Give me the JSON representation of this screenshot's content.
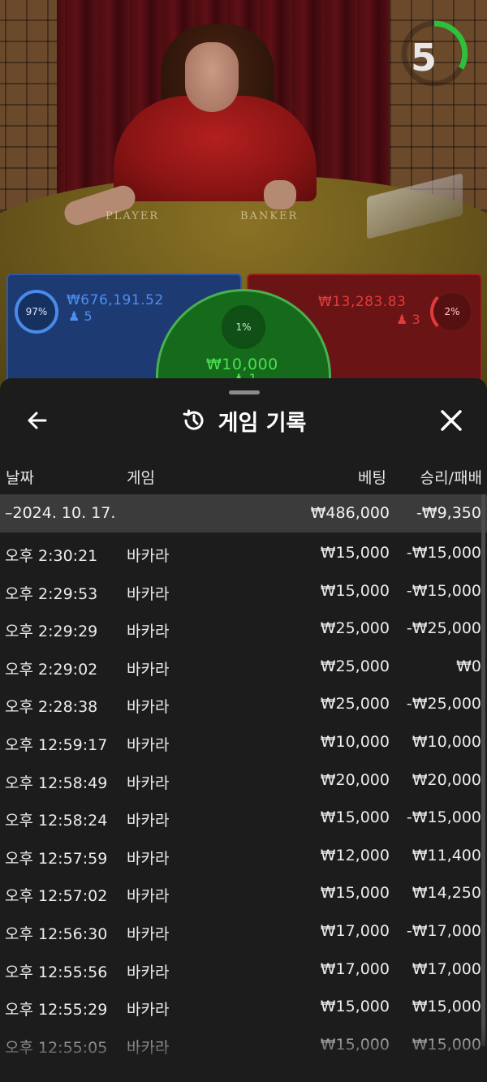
{
  "live": {
    "countdown": "5",
    "table_labels": {
      "player": "PLAYER",
      "banker": "BANKER"
    },
    "bets": {
      "player": {
        "percent": "97%",
        "amount": "₩676,191.52",
        "count": "5",
        "color": "#2f58a8"
      },
      "banker": {
        "percent": "2%",
        "amount": "₩13,283.83",
        "count": "3",
        "color": "#a3201f"
      },
      "tie": {
        "percent": "1%",
        "amount": "₩10,000",
        "count": "1",
        "color": "#4ab04e"
      }
    }
  },
  "history": {
    "title": "게임 기록",
    "icons": {
      "back": "arrow-left-icon",
      "title": "history-icon",
      "close": "close-icon",
      "person": "person-icon"
    },
    "columns": {
      "date": "날짜",
      "game": "게임",
      "bet": "베팅",
      "win_loss": "승리/패배"
    },
    "date_group": {
      "label": "–2024. 10. 17.",
      "bet": "₩486,000",
      "win_loss": "-₩9,350"
    },
    "rows": [
      {
        "time": "오후 2:30:21",
        "game": "바카라",
        "bet": "₩15,000",
        "win_loss": "-₩15,000"
      },
      {
        "time": "오후 2:29:53",
        "game": "바카라",
        "bet": "₩15,000",
        "win_loss": "-₩15,000"
      },
      {
        "time": "오후 2:29:29",
        "game": "바카라",
        "bet": "₩25,000",
        "win_loss": "-₩25,000"
      },
      {
        "time": "오후 2:29:02",
        "game": "바카라",
        "bet": "₩25,000",
        "win_loss": "₩0"
      },
      {
        "time": "오후 2:28:38",
        "game": "바카라",
        "bet": "₩25,000",
        "win_loss": "-₩25,000"
      },
      {
        "time": "오후 12:59:17",
        "game": "바카라",
        "bet": "₩10,000",
        "win_loss": "₩10,000"
      },
      {
        "time": "오후 12:58:49",
        "game": "바카라",
        "bet": "₩20,000",
        "win_loss": "₩20,000"
      },
      {
        "time": "오후 12:58:24",
        "game": "바카라",
        "bet": "₩15,000",
        "win_loss": "-₩15,000"
      },
      {
        "time": "오후 12:57:59",
        "game": "바카라",
        "bet": "₩12,000",
        "win_loss": "₩11,400"
      },
      {
        "time": "오후 12:57:02",
        "game": "바카라",
        "bet": "₩15,000",
        "win_loss": "₩14,250"
      },
      {
        "time": "오후 12:56:30",
        "game": "바카라",
        "bet": "₩17,000",
        "win_loss": "-₩17,000"
      },
      {
        "time": "오후 12:55:56",
        "game": "바카라",
        "bet": "₩17,000",
        "win_loss": "₩17,000"
      },
      {
        "time": "오후 12:55:29",
        "game": "바카라",
        "bet": "₩15,000",
        "win_loss": "₩15,000"
      },
      {
        "time": "오후 12:55:05",
        "game": "바카라",
        "bet": "₩15,000",
        "win_loss": "₩15,000"
      }
    ]
  }
}
